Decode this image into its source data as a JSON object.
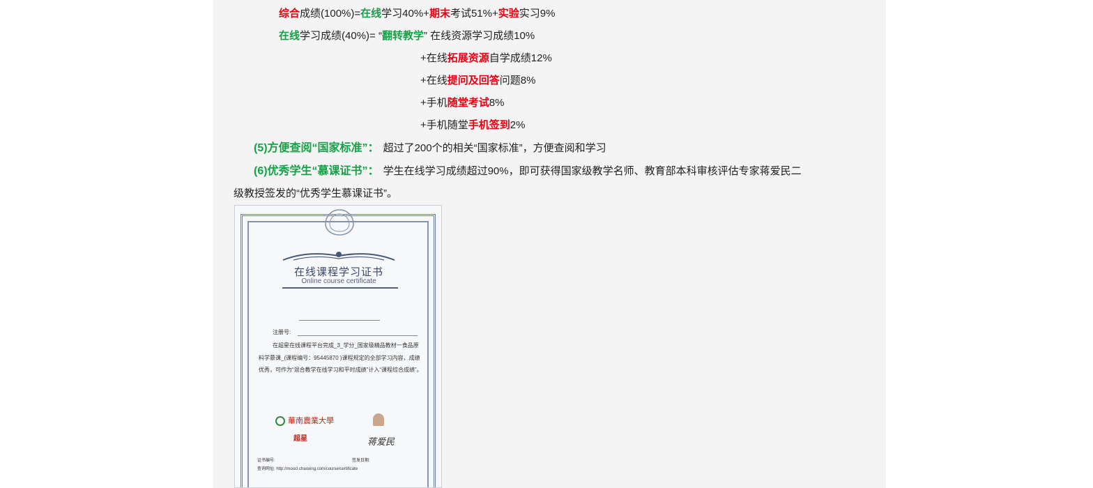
{
  "grade_formula": {
    "overall": {
      "p1": "综合",
      "p2": "成绩(100%)=",
      "p3": "在线",
      "p4": "学习40%+",
      "p5": "期末",
      "p6": "考试51%+",
      "p7": "实验",
      "p8": "实习9%"
    },
    "online": {
      "p1": "在线",
      "p2": "学习成绩(40%)= “",
      "p3": "翻转教学",
      "p4": "” 在线资源学习成绩10%"
    },
    "items": [
      {
        "pre": "+在线",
        "em": "拓展资源",
        "post": "自学成绩12%"
      },
      {
        "pre": "+在线",
        "em": "提问及回答",
        "post": "问题8%"
      },
      {
        "pre": "+手机",
        "em": "随堂考试",
        "post": "8%"
      },
      {
        "pre": "+手机随堂",
        "em": "手机签到",
        "post": "2%"
      }
    ]
  },
  "section5": {
    "heading": "(5)方便查阅“国家标准”：",
    "text": "超过了200个的相关“国家标准”，方便查阅和学习"
  },
  "section6": {
    "heading": "(6)优秀学生“慕课证书”：",
    "text1": "学生在线学习成绩超过90%，即可获得国家级教学名师、教育部本科审核评估专家蒋爱民二",
    "text2": "级教授签发的“优秀学生慕课证书”。"
  },
  "certificate": {
    "title": "在线课程学习证书",
    "subtitle": "Online course certificate",
    "reg_label": "注册号:",
    "body": "在超星在线课程平台完成_3_学分_国家级精品教材一食品原料学慕课_(课程编号：95445870 )课程规定的全部学习内容，成绩优秀，可作为“混合教学在线学习和平时成绩”计入“课程综合成绩”。",
    "school_logo": "華南農業大學",
    "platform_logo": "超星",
    "cert_no_label": "证书编号:",
    "issue_date_label": "签发日期:",
    "query_url": "查询网址: http://moocl.chaoxing.com/course/certificate",
    "signature": "蒋爱民"
  },
  "colors": {
    "red": "#e60012",
    "green": "#16a048",
    "panel_bg": "#f4f4f4"
  }
}
